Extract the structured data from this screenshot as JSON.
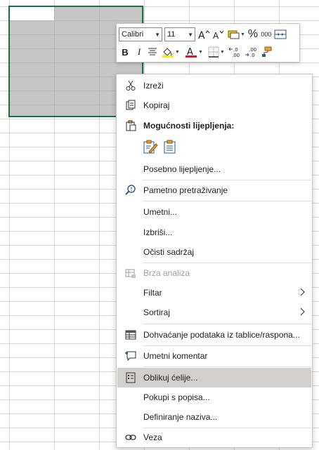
{
  "mini_toolbar": {
    "font_name": "Calibri",
    "font_size": "11",
    "bold": "B",
    "italic": "I",
    "percent": "%",
    "thousands": "000",
    "fill_color": "#ffeb00",
    "font_color": "#e81123"
  },
  "context_menu": {
    "items": [
      {
        "label": "Izreži",
        "icon": "scissors-icon"
      },
      {
        "label": "Kopiraj",
        "icon": "copy-icon"
      },
      {
        "label": "Mogućnosti lijepljenja:",
        "icon": "paste-icon"
      },
      {
        "label": "Posebno lijepljenje..."
      },
      {
        "label": "Pametno pretraživanje",
        "icon": "smart-lookup-icon"
      },
      {
        "label": "Umetni..."
      },
      {
        "label": "Izbriši..."
      },
      {
        "label": "Očisti sadržaj"
      },
      {
        "label": "Brza analiza",
        "icon": "quick-analysis-icon",
        "disabled": true
      },
      {
        "label": "Filtar"
      },
      {
        "label": "Sortiraj"
      },
      {
        "label": "Dohvaćanje podataka iz tablice/raspona...",
        "icon": "table-icon"
      },
      {
        "label": "Umetni komentar",
        "icon": "comment-icon"
      },
      {
        "label": "Oblikuj ćelije...",
        "icon": "format-cells-icon"
      },
      {
        "label": "Pokupi s popisa..."
      },
      {
        "label": "Definiranje naziva..."
      },
      {
        "label": "Veza",
        "icon": "link-icon"
      }
    ]
  },
  "colors": {
    "accent_green": "#1e7145",
    "hover_bg": "#d2d0ce",
    "icon_blue": "#2b579a"
  }
}
